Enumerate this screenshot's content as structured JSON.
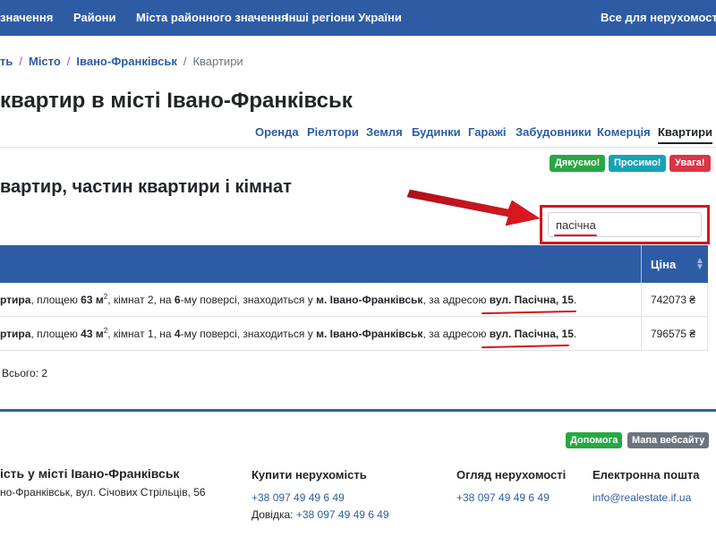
{
  "topnav": {
    "items": [
      "значення",
      "Райони",
      "Міста районного значення",
      "Інші регіони України"
    ],
    "right": "Все для нерухомості"
  },
  "breadcrumb": {
    "items": [
      "ть",
      "Місто",
      "Івано-Франківськ"
    ],
    "current": "Квартири"
  },
  "page_title": "квартир в місті Івано-Франківськ",
  "tabs": [
    "Оренда",
    "Ріелтори",
    "Земля",
    "Будинки",
    "Гаражі",
    "Забудовники",
    "Комерція",
    "Квартири"
  ],
  "active_tab": "Квартири",
  "badges": {
    "thanks": "Дякуємо!",
    "please": "Просимо!",
    "attention": "Увага!"
  },
  "subtitle": "вартир, частин квартири і кімнат",
  "search": {
    "value": "пасічна"
  },
  "table": {
    "price_header": "Ціна",
    "rows": [
      {
        "type": "ртира",
        "area_label": ", площею",
        "area": "63",
        "unit": "м",
        "unit_sup": "2",
        "rooms_text": ", кімнат 2, на",
        "floor": "6",
        "floor_text": "-му поверсі, знаходиться у",
        "city": "м. Івано-Франківськ",
        "addr_text": ", за адресою",
        "address": "вул. Пасічна, 15",
        "end": ".",
        "price": "742073 ₴"
      },
      {
        "type": "ртира",
        "area_label": ", площею",
        "area": "43",
        "unit": "м",
        "unit_sup": "2",
        "rooms_text": ", кімнат 1, на",
        "floor": "4",
        "floor_text": "-му поверсі, знаходиться у",
        "city": "м. Івано-Франківськ",
        "addr_text": ", за адресою",
        "address": "вул. Пасічна, 15",
        "end": ".",
        "price": "796575 ₴"
      }
    ],
    "total": "Всього: 2"
  },
  "footer": {
    "help": "Допомога",
    "sitemap": "Мапа вебсайту",
    "col1_title": "ість у місті Івано-Франківськ",
    "col1_addr": "но-Франківськ, вул. Січових Стрільців, 56",
    "col2_title": "Купити нерухомість",
    "col2_phone": "+38 097 49 49 6 49",
    "col2_label": "Довідка:",
    "col2_phone2": "+38 097 49 49 6 49",
    "col3_title": "Огляд нерухомості",
    "col3_phone": "+38 097 49 49 6 49",
    "col4_title": "Електронна пошта",
    "col4_email": "info@realestate.if.ua"
  },
  "colors": {
    "brand": "#2d5ca5",
    "annotation": "#d6151d",
    "success": "#28a745",
    "info": "#17a2b8",
    "danger": "#dc3545",
    "secondary": "#6c757d"
  }
}
